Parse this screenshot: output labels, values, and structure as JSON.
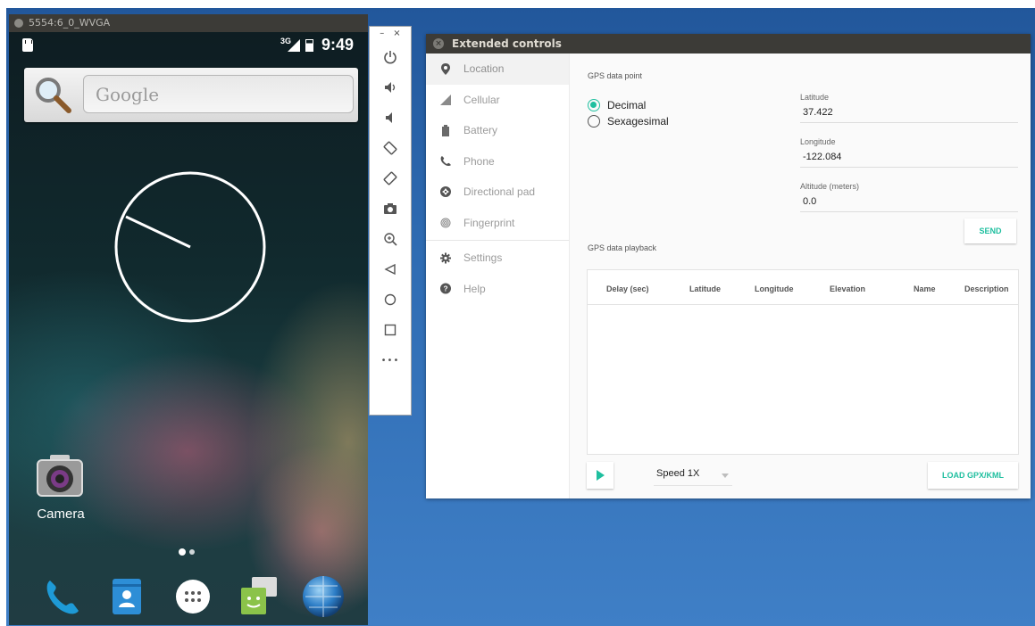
{
  "phone_window": {
    "title": "5554:6_0_WVGA",
    "status": {
      "network": "3G",
      "time": "9:49"
    },
    "search_placeholder": "Google",
    "camera_label": "Camera",
    "dock": [
      "phone-icon",
      "contacts-icon",
      "app-drawer-icon",
      "messaging-icon",
      "browser-icon"
    ]
  },
  "toolbar": {
    "minimize": "–",
    "close": "×",
    "buttons": [
      "power-icon",
      "volume-up-icon",
      "volume-down-icon",
      "rotate-left-icon",
      "rotate-right-icon",
      "screenshot-icon",
      "zoom-icon",
      "back-icon",
      "home-icon",
      "overview-icon",
      "more-icon"
    ],
    "more_label": "•••"
  },
  "extended": {
    "title": "Extended controls",
    "nav": [
      {
        "label": "Location",
        "icon": "location-pin-icon"
      },
      {
        "label": "Cellular",
        "icon": "signal-icon"
      },
      {
        "label": "Battery",
        "icon": "battery-icon"
      },
      {
        "label": "Phone",
        "icon": "phone-icon"
      },
      {
        "label": "Directional pad",
        "icon": "dpad-icon"
      },
      {
        "label": "Fingerprint",
        "icon": "fingerprint-icon"
      },
      {
        "label": "Settings",
        "icon": "gear-icon"
      },
      {
        "label": "Help",
        "icon": "help-icon"
      }
    ],
    "gps_point_label": "GPS data point",
    "format_options": [
      "Decimal",
      "Sexagesimal"
    ],
    "selected_format": "Decimal",
    "latitude_label": "Latitude",
    "latitude_value": "37.422",
    "longitude_label": "Longitude",
    "longitude_value": "-122.084",
    "altitude_label": "Altitude (meters)",
    "altitude_value": "0.0",
    "send_label": "SEND",
    "playback_label": "GPS data playback",
    "columns": [
      "Delay (sec)",
      "Latitude",
      "Longitude",
      "Elevation",
      "Name",
      "Description"
    ],
    "speed_label": "Speed 1X",
    "load_label": "LOAD GPX/KML"
  },
  "colors": {
    "accent": "#1fbf9f",
    "desktop": "#2f6cb3",
    "titlebar": "#3c3b37"
  }
}
